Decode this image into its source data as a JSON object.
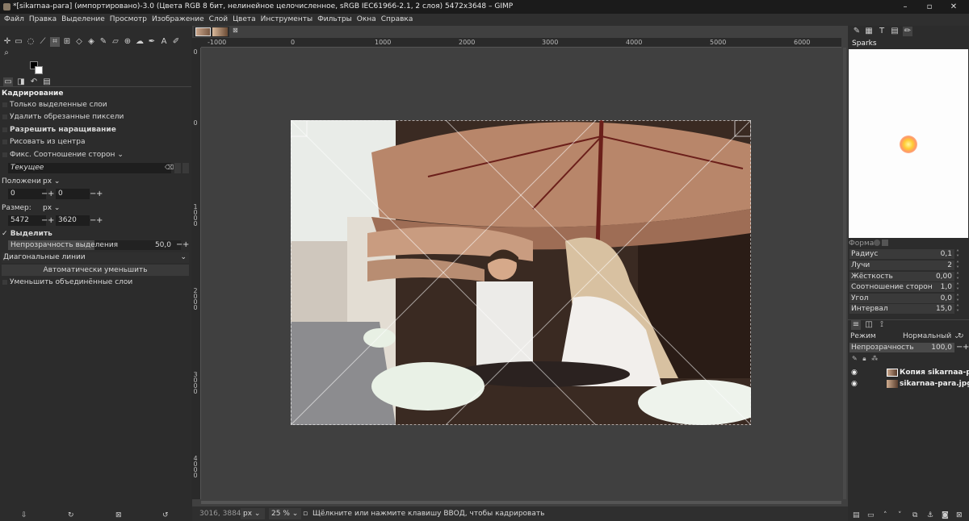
{
  "window": {
    "title": "*[sikarnaa-para] (импортировано)-3.0 (Цвета RGB 8 бит, нелинейное целочисленное, sRGB IEC61966-2.1, 2 слоя) 5472x3648 – GIMP",
    "minimize": "–",
    "maximize": "▫",
    "close": "✕"
  },
  "menu": [
    "Файл",
    "Правка",
    "Выделение",
    "Просмотр",
    "Изображение",
    "Слой",
    "Цвета",
    "Инструменты",
    "Фильтры",
    "Окна",
    "Справка"
  ],
  "tool_options": {
    "title": "Кадрирование",
    "only_selected_layers": "Только выделенные слои",
    "delete_cropped": "Удалить обрезанные пиксели",
    "allow_growing": "Разрешить наращивание",
    "expand_from_center": "Рисовать из центра",
    "fixed_aspect": "Фикс. Соотношение сторон",
    "current": "Текущее",
    "position_label": "Положение:",
    "position_unit": "px",
    "pos_x": "0",
    "pos_y": "0",
    "size_label": "Размер:",
    "size_unit": "px",
    "width": "5472",
    "height": "3620",
    "highlight": "Выделить",
    "highlight_opacity_label": "Непрозрачность выделения",
    "highlight_opacity": "50,0",
    "guides": "Диагональные линии",
    "auto_shrink": "Автоматически уменьшить",
    "shrink_merged": "Уменьшить объединённые слои"
  },
  "rulers": {
    "h": [
      "-1000",
      "0",
      "1000",
      "2000",
      "3000",
      "4000",
      "5000",
      "6000"
    ],
    "v": [
      "0",
      "0",
      "1000",
      "2000",
      "3000",
      "4000"
    ]
  },
  "status": {
    "coords": "3016, 3884",
    "unit": "px",
    "zoom": "25 %",
    "message": "Щёлкните или нажмите клавишу ВВОД, чтобы кадрировать"
  },
  "brushes": {
    "brush_name": "Sparks",
    "form_label": "Форма:",
    "params": [
      {
        "label": "Радиус",
        "value": "0,1"
      },
      {
        "label": "Лучи",
        "value": "2"
      },
      {
        "label": "Жёсткость",
        "value": "0,00"
      },
      {
        "label": "Соотношение сторон",
        "value": "1,0"
      },
      {
        "label": "Угол",
        "value": "0,0"
      },
      {
        "label": "Интервал",
        "value": "15,0"
      }
    ]
  },
  "layers": {
    "mode_label": "Режим",
    "mode_value": "Нормальный",
    "opacity_label": "Непрозрачность",
    "opacity_value": "100,0",
    "items": [
      {
        "name": "Копия sikarnaa-para."
      },
      {
        "name": "sikarnaa-para.jpg"
      }
    ]
  }
}
